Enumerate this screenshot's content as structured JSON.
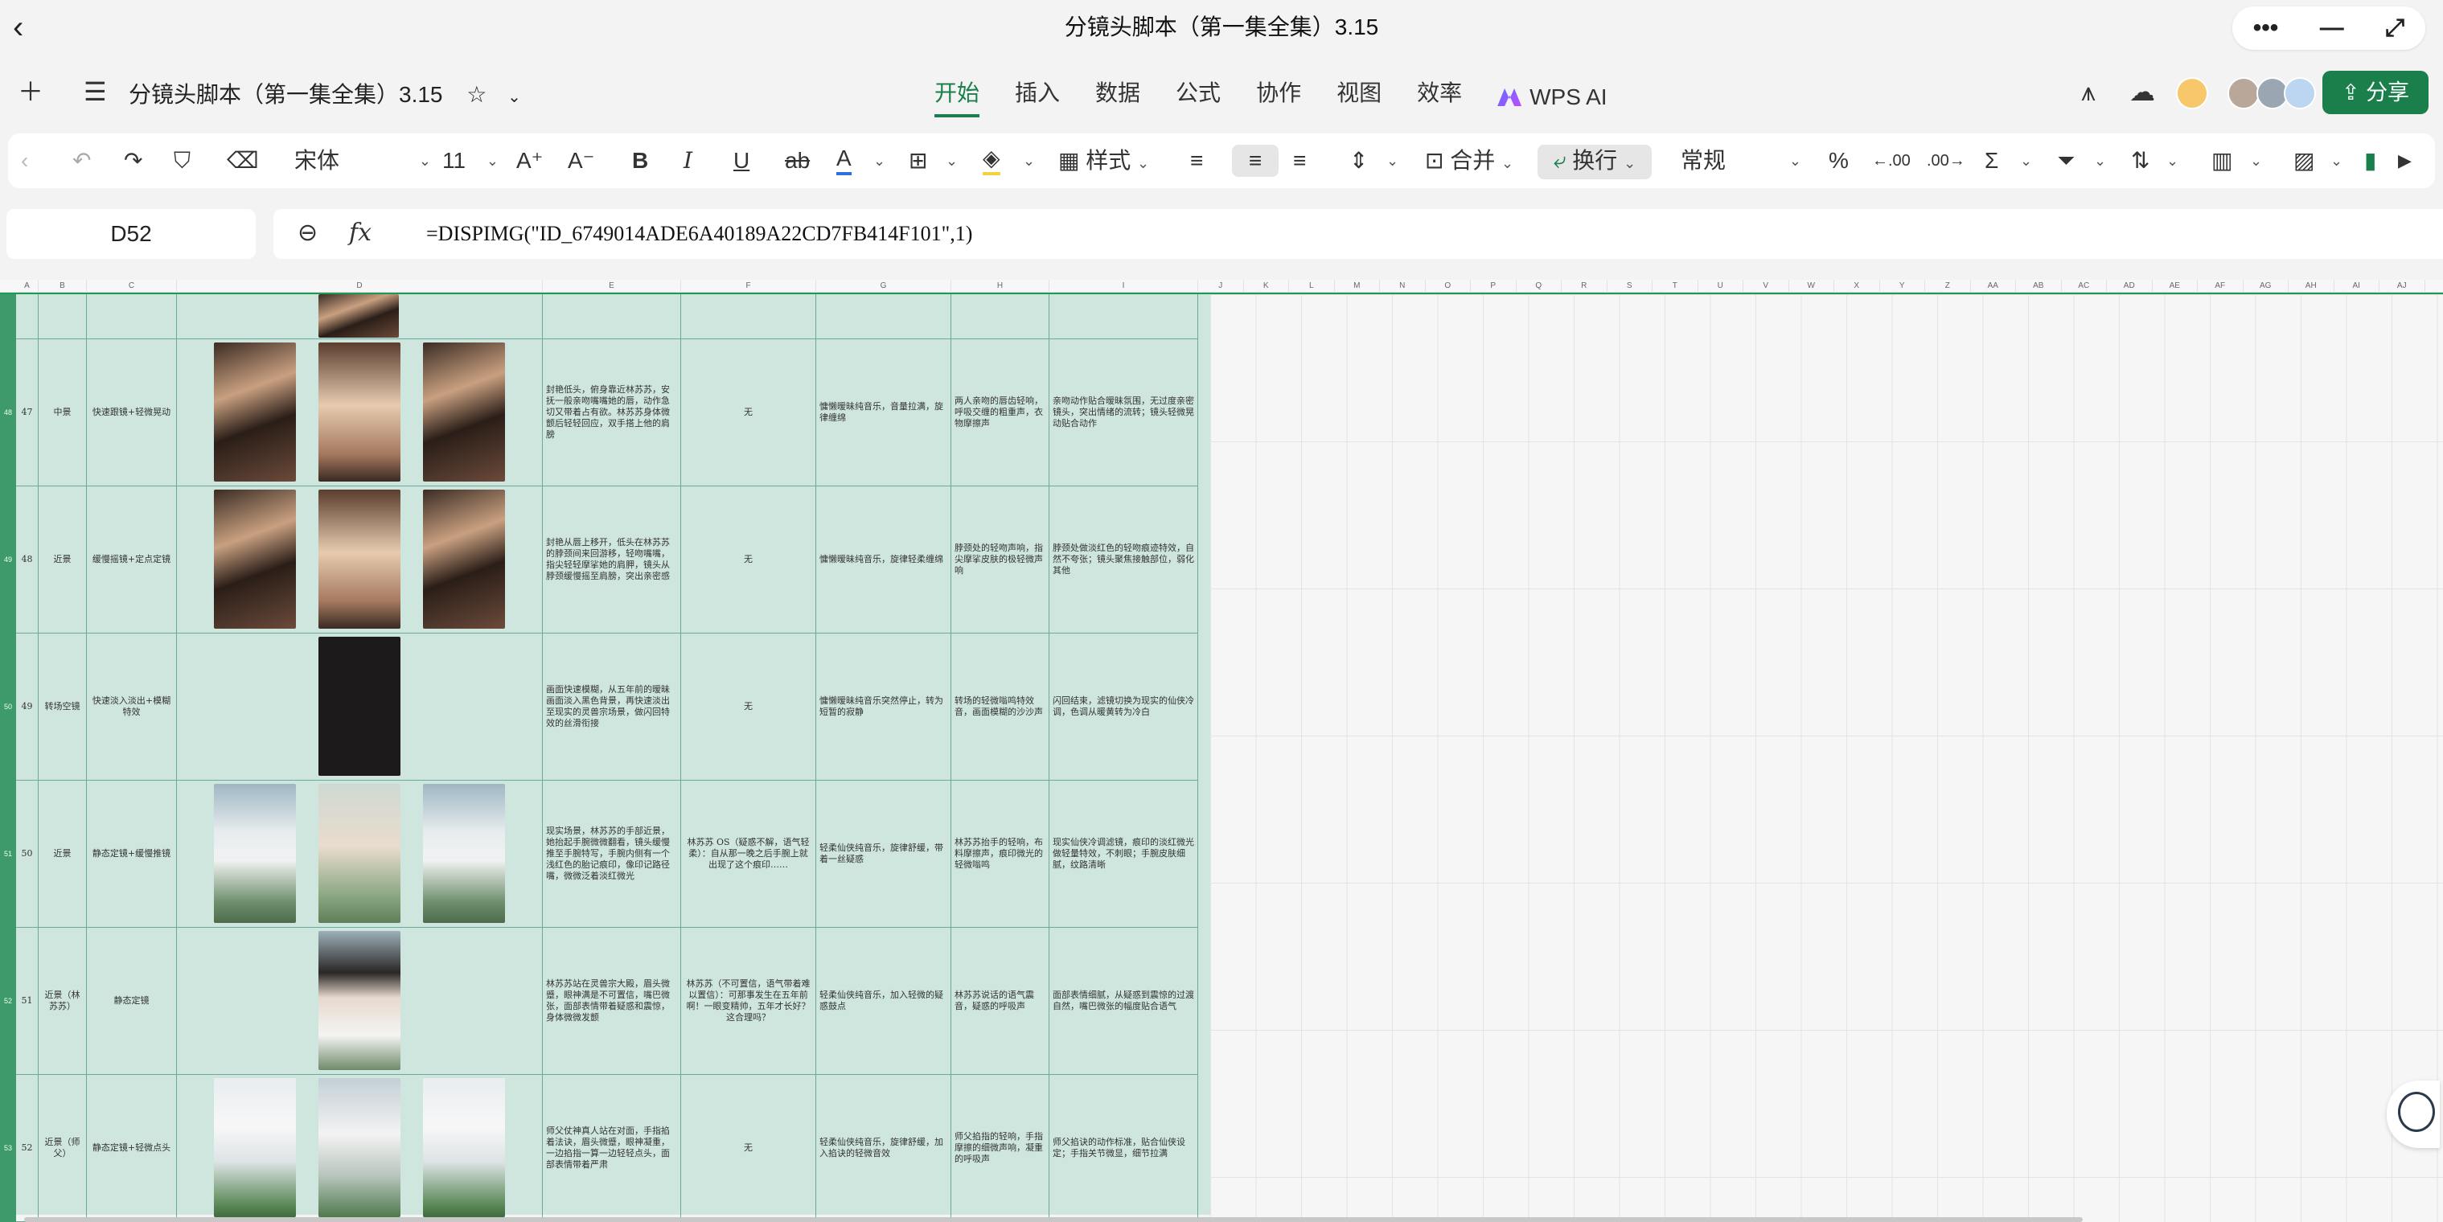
{
  "title_bar": {
    "title": "分镜头脚本（第一集全集）3.15"
  },
  "menu_bar": {
    "doc_title": "分镜头脚本（第一集全集）3.15",
    "tabs": [
      "开始",
      "插入",
      "数据",
      "公式",
      "协作",
      "视图",
      "效率"
    ],
    "active_tab": "开始",
    "wps_ai": "WPS AI",
    "share": "分享"
  },
  "toolbar": {
    "font_name": "宋体",
    "font_size": "11",
    "style_label": "样式",
    "merge_label": "合并",
    "wrap_label": "换行",
    "number_format": "常规",
    "percent": "%"
  },
  "formula_bar": {
    "cell_ref": "D52",
    "formula": "=DISPIMG(\"ID_6749014ADE6A40189A22CD7FB414F101\",1)"
  },
  "columns": [
    "A",
    "B",
    "C",
    "D",
    "E",
    "F",
    "G",
    "H",
    "I",
    "J",
    "K",
    "L",
    "M",
    "N",
    "O",
    "P",
    "Q",
    "R",
    "S",
    "T",
    "U",
    "V",
    "W",
    "X",
    "Y",
    "Z",
    "AA",
    "AB",
    "AC",
    "AD",
    "AE",
    "AF",
    "AG",
    "AH",
    "AI",
    "AJ"
  ],
  "rows": [
    {
      "num": "47",
      "shot": "中景",
      "move": "快速跟镜+轻微晃动",
      "pics": [
        "dark",
        "warm",
        "dark"
      ],
      "desc": "封艳低头，俯身靠近林苏苏，安抚一般亲吻嘴嘴她的唇，动作急切又带着占有欲。林苏苏身体微颤后轻轻回应，双手搭上他的肩膀",
      "dialog": "无",
      "music": "慵懒暧昧纯音乐，音量拉满，旋律缠绵",
      "sfx": "两人亲吻的唇齿轻响，呼吸交缠的粗重声，衣物摩擦声",
      "note": "亲吻动作贴合暧昧氛围，无过度亲密镜头，突出情绪的流转；镜头轻微晃动贴合动作"
    },
    {
      "num": "48",
      "shot": "近景",
      "move": "缓慢摇镜+定点定镜",
      "pics": [
        "dark",
        "warm",
        "dark"
      ],
      "desc": "封艳从唇上移开，低头在林苏苏的脖颈间来回游移，轻吻嘴嘴，指尖轻轻摩挲她的肩胛，镜头从脖颈缓慢摇至肩膀，突出亲密感",
      "dialog": "无",
      "music": "慵懒暧昧纯音乐，旋律轻柔缠绵",
      "sfx": "脖颈处的轻吻声响，指尖摩挲皮肤的极轻微声响",
      "note": "脖颈处做淡红色的轻吻痕迹特效，自然不夸张；镜头聚焦接触部位，弱化其他"
    },
    {
      "num": "49",
      "shot": "转场空镜",
      "move": "快速淡入淡出+模糊特效",
      "pics": [
        "",
        "black",
        ""
      ],
      "desc": "画面快速模糊，从五年前的暧昧画面淡入黑色背景，再快速淡出至现实的灵兽宗场景，做闪回特效的丝滑衔接",
      "dialog": "无",
      "music": "慵懒暧昧纯音乐突然停止，转为短暂的寂静",
      "sfx": "转场的轻微嗡鸣特效音，画面模糊的沙沙声",
      "note": "闪回结束，滤镜切换为现实的仙侠冷调，色调从暖黄转为冷白"
    },
    {
      "num": "50",
      "shot": "近景",
      "move": "静态定镜+缓慢推镜",
      "pics": [
        "nature",
        "hands",
        "nature"
      ],
      "desc": "现实场景，林苏苏的手部近景，她抬起手腕微微翻看，镜头缓慢推至手腕特写，手腕内侧有一个浅红色的胎记痕印，像印记路径嘴，微微泛着淡红微光",
      "dialog": "林苏苏 OS（疑惑不解，语气轻柔）：自从那一晚之后手腕上就出现了这个痕印……",
      "music": "轻柔仙侠纯音乐，旋律舒缓，带着一丝疑惑",
      "sfx": "林苏苏抬手的轻响，布料摩擦声，痕印微光的轻微嗡鸣",
      "note": "现实仙侠冷调滤镜，痕印的淡红微光做轻量特效，不刺眼；手腕皮肤细腻，纹路清晰"
    },
    {
      "num": "51",
      "shot": "近景（林苏苏）",
      "move": "静态定镜",
      "pics": [
        "",
        "face",
        ""
      ],
      "desc": "林苏苏站在灵兽宗大殿，眉头微蹙，眼神满是不可置信，嘴巴微张，面部表情带着疑惑和震惊，身体微微发颤",
      "dialog": "林苏苏（不可置信，语气带着难以置信）：可那事发生在五年前啊！一眼变精帅，五年才长好？这合理吗？",
      "music": "轻柔仙侠纯音乐，加入轻微的疑惑鼓点",
      "sfx": "林苏苏说话的语气震音，疑惑的呼吸声",
      "note": "面部表情细腻，从疑惑到震惊的过渡自然，嘴巴微张的幅度贴合语气"
    },
    {
      "num": "52",
      "shot": "近景（师父）",
      "move": "静态定镜+轻微点头",
      "pics": [
        "elder",
        "fall",
        "elder"
      ],
      "desc": "师父仗神真人站在对面，手指掐着法诀，眉头微蹙，眼神凝重，一边掐指一算一边轻轻点头，面部表情带着严肃",
      "dialog": "无",
      "music": "轻柔仙侠纯音乐，旋律舒缓，加入掐诀的轻微音效",
      "sfx": "师父掐指的轻响，手指摩擦的细微声响，凝重的呼吸声",
      "note": "师父掐诀的动作标准，贴合仙侠设定；手指关节微显，细节拉满"
    }
  ],
  "row_header_labels": [
    "48",
    "49",
    "50",
    "51",
    "52",
    "53"
  ]
}
